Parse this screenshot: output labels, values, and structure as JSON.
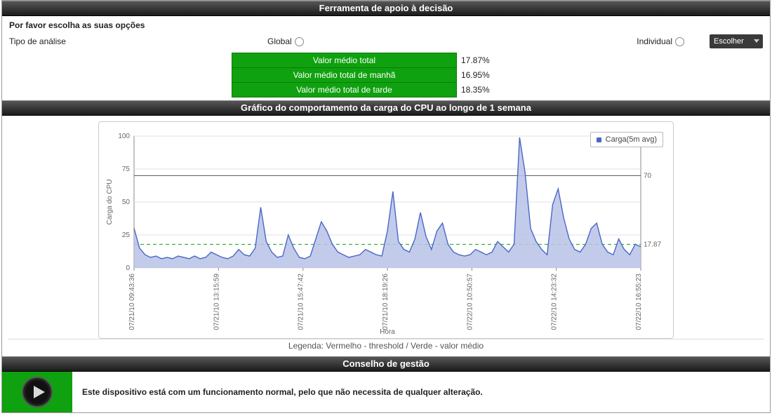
{
  "header": {
    "title": "Ferramenta de apoio à decisão"
  },
  "opts_prompt": "Por favor escolha as suas opções",
  "analysis_type_label": "Tipo de análise",
  "radios": {
    "global_label": "Global",
    "individual_label": "Individual",
    "select_placeholder": "Escolher"
  },
  "metrics": [
    {
      "label": "Valor médio total",
      "value": "17.87%"
    },
    {
      "label": "Valor médio total de manhã",
      "value": "16.95%"
    },
    {
      "label": "Valor médio total de tarde",
      "value": "18.35%"
    }
  ],
  "chart_header": "Gráfico do comportamento da carga do CPU ao longo de 1 semana",
  "legend_box": "Carga(5m avg)",
  "legend_line": "Legenda: Vermelho - threshold / Verde - valor médio",
  "advice_header": "Conselho de gestão",
  "advice_text": "Este dispositivo está com um funcionamento normal, pelo que não necessita de qualquer alteração.",
  "chart_data": {
    "type": "line",
    "title": "",
    "xlabel": "Hora",
    "ylabel": "Carga do CPU",
    "ylim": [
      0,
      100
    ],
    "yticks": [
      0,
      25,
      50,
      75,
      100
    ],
    "xticks": [
      "07/21/10 09:43:36",
      "07/21/10 13:15:59",
      "07/21/10 15:47:42",
      "07/21/10 18:19:26",
      "07/22/10 10:50:57",
      "07/22/10 14:23:32",
      "07/22/10 16:55:23"
    ],
    "threshold": 70,
    "mean": 17.87,
    "mean_label": "17.87",
    "series": [
      {
        "name": "Carga(5m avg)",
        "color": "#4a67c6",
        "values": [
          30,
          15,
          10,
          8,
          9,
          7,
          8,
          7,
          9,
          8,
          7,
          9,
          7,
          8,
          12,
          10,
          8,
          7,
          9,
          14,
          10,
          9,
          15,
          46,
          20,
          12,
          8,
          9,
          25,
          15,
          8,
          7,
          9,
          22,
          35,
          28,
          18,
          12,
          10,
          8,
          9,
          10,
          14,
          12,
          10,
          9,
          28,
          58,
          20,
          14,
          12,
          22,
          42,
          24,
          14,
          28,
          34,
          18,
          12,
          10,
          9,
          10,
          14,
          12,
          10,
          12,
          20,
          16,
          12,
          18,
          99,
          72,
          30,
          20,
          14,
          10,
          48,
          60,
          38,
          22,
          14,
          12,
          18,
          30,
          34,
          18,
          12,
          10,
          22,
          14,
          10,
          18,
          16
        ]
      }
    ]
  }
}
